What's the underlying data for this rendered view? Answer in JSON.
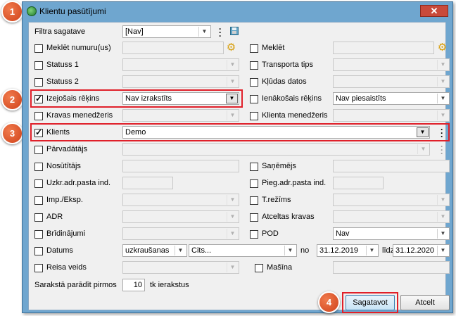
{
  "window": {
    "title": "Klientu pasūtījumi",
    "close_glyph": "✕"
  },
  "filter": {
    "label": "Filtra sagatave",
    "value": "[Nav]"
  },
  "rows": {
    "meklet_numuru": "Meklēt numuru(us)",
    "meklet": "Meklēt",
    "statuss1": "Statuss 1",
    "transporta_tips": "Transporta tips",
    "statuss2": "Statuss 2",
    "kludas_datos": "Kļūdas datos",
    "izejosais_rekins": "Izejošais rēķins",
    "izejosais_value": "Nav izrakstīts",
    "ienakosais_rekins": "Ienākošais rēķins",
    "ienakosais_value": "Nav piesaistīts",
    "kravas_menedzeris": "Kravas menedžeris",
    "klienta_menedzeris": "Klienta menedžeris",
    "klients": "Klients",
    "klients_value": "Demo",
    "parvadatajs": "Pārvadātājs",
    "nosutitajs": "Nosūtītājs",
    "sanemejs": "Saņēmējs",
    "uzkr_adr": "Uzkr.adr.pasta ind.",
    "pieg_adr": "Pieg.adr.pasta ind.",
    "imp_eksp": "Imp./Eksp.",
    "t_rezims": "T.režīms",
    "adr": "ADR",
    "atceltas_kravas": "Atceltas kravas",
    "bridinajumi": "Brīdinājumi",
    "pod": "POD",
    "pod_value": "Nav",
    "datums": "Datums",
    "datums_type": "uzkraušanas",
    "datums_period": "Cits...",
    "no": "no",
    "date_from": "31.12.2019",
    "lidz": "līdz",
    "date_to": "31.12.2020",
    "reisa_veids": "Reisa veids",
    "masina": "Mašīna",
    "saraksta_prefix": "Sarakstā parādīt pirmos",
    "saraksta_count": "10",
    "saraksta_suffix": "tk ierakstus"
  },
  "checked": {
    "izejosais_rekins": true,
    "klients": true
  },
  "buttons": {
    "sagatavot": "Sagatavot",
    "atcelt": "Atcelt"
  },
  "badges": [
    "1",
    "2",
    "3",
    "4"
  ],
  "colors": {
    "highlight": "#e0202a",
    "badge": "#e05a2a",
    "window_frame": "#6fa6cf"
  }
}
